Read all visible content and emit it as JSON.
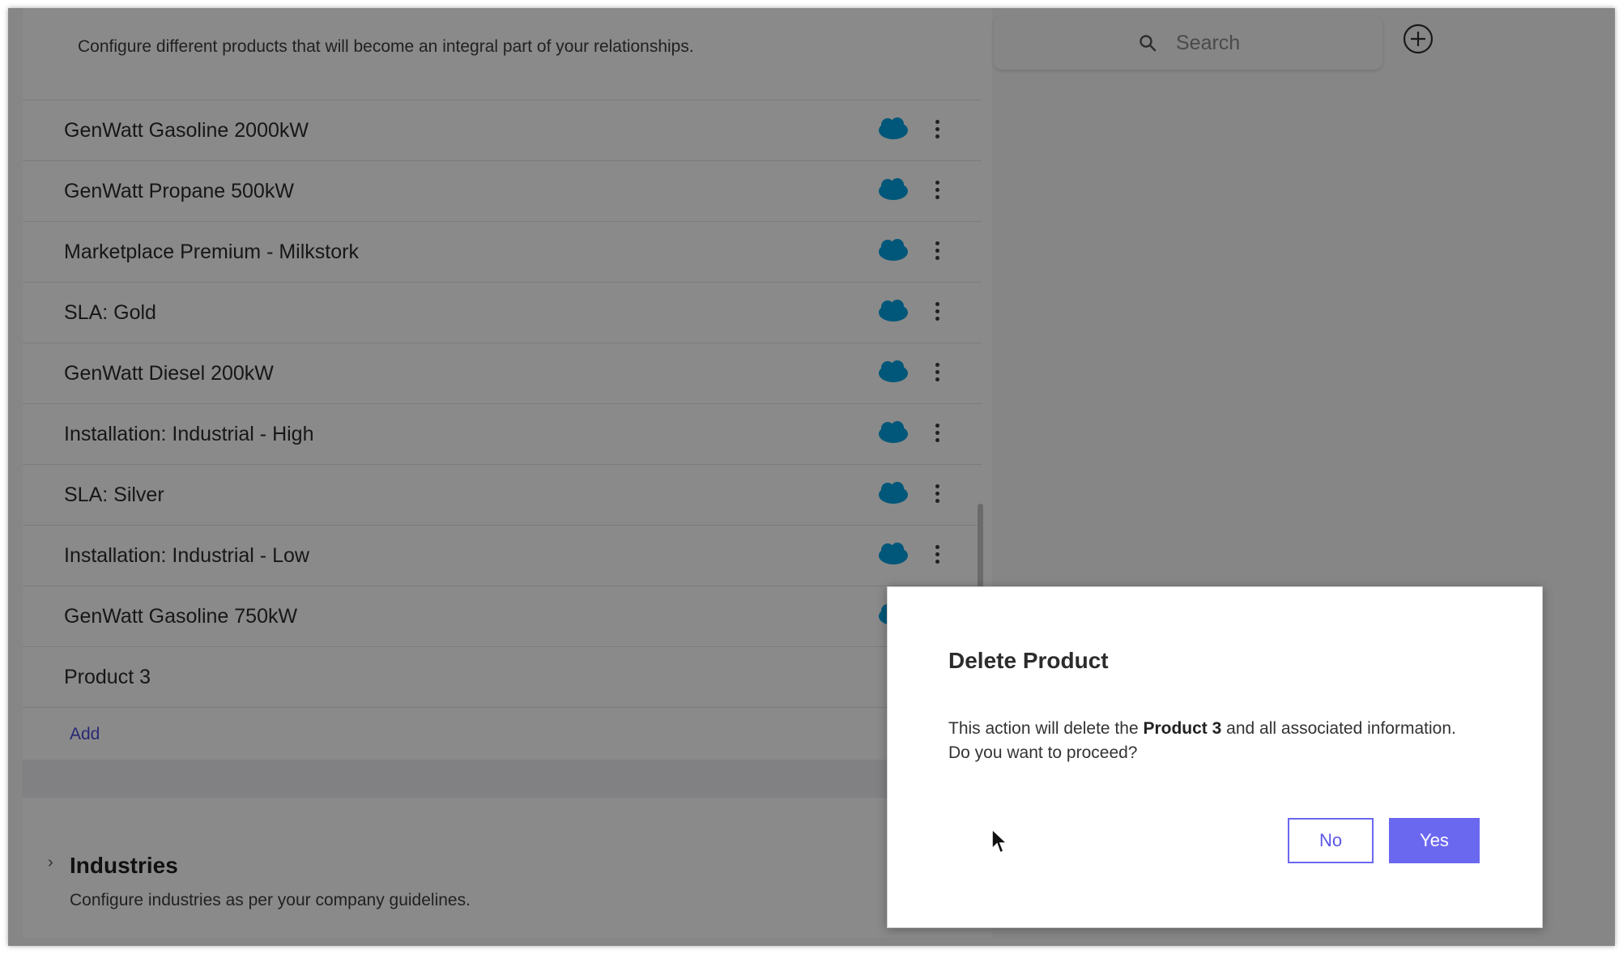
{
  "products_section": {
    "description": "Configure different products that will become an integral part of your relationships.",
    "items": [
      {
        "name": "GenWatt Gasoline 2000kW"
      },
      {
        "name": "GenWatt Propane 500kW"
      },
      {
        "name": "Marketplace Premium - Milkstork"
      },
      {
        "name": "SLA: Gold"
      },
      {
        "name": "GenWatt Diesel 200kW"
      },
      {
        "name": "Installation: Industrial - High"
      },
      {
        "name": "SLA: Silver"
      },
      {
        "name": "Installation: Industrial - Low"
      },
      {
        "name": "GenWatt Gasoline 750kW"
      },
      {
        "name": "Product 3"
      }
    ],
    "add_label": "Add"
  },
  "industries_section": {
    "title": "Industries",
    "description": "Configure industries as per your company guidelines."
  },
  "search": {
    "placeholder": "Search"
  },
  "dialog": {
    "title": "Delete Product",
    "message_prefix": "This action will delete the",
    "message_product": "Product 3",
    "message_suffix": "and all associated information.",
    "message_line2": "Do you want to proceed?",
    "no_label": "No",
    "yes_label": "Yes"
  },
  "colors": {
    "accent": "#6b68f0",
    "salesforce_blue": "#00a1e0",
    "overlay": "rgba(0,0,0,0.46)"
  },
  "icons": [
    "salesforce-icon",
    "kebab-menu-icon",
    "search-icon",
    "add-circle-icon",
    "chevron-right-icon",
    "mouse-cursor-icon"
  ]
}
